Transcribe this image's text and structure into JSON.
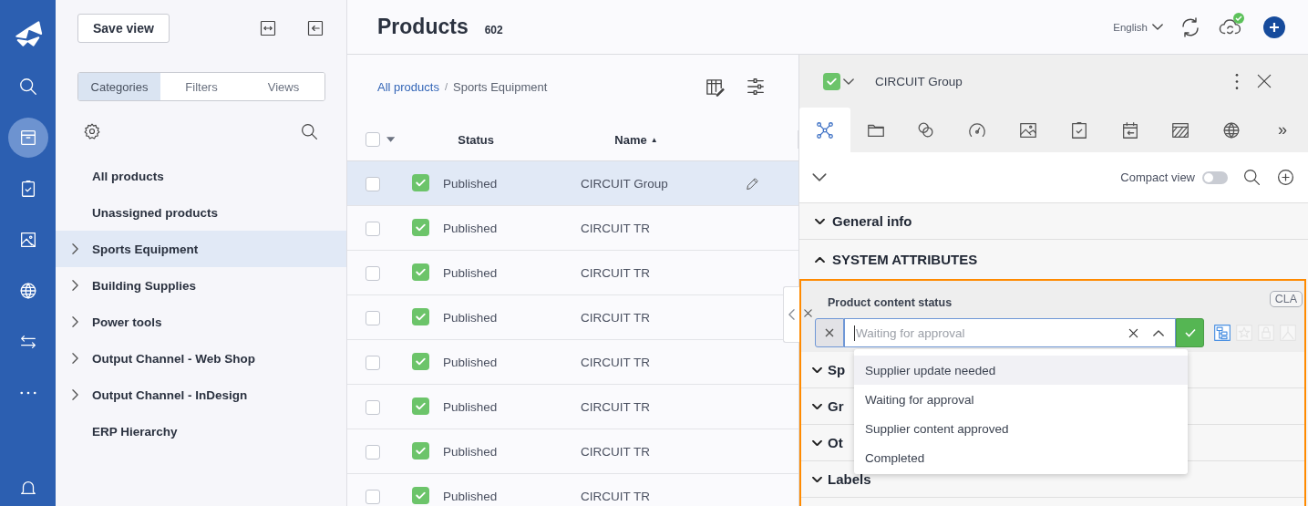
{
  "nav_rail": [
    {
      "kind": "logo",
      "selected": false
    },
    {
      "kind": "search",
      "selected": false
    },
    {
      "kind": "box",
      "selected": true
    },
    {
      "kind": "clipboard",
      "selected": false
    },
    {
      "kind": "image",
      "selected": false
    },
    {
      "kind": "globe",
      "selected": false
    },
    {
      "kind": "arrows",
      "selected": false
    },
    {
      "kind": "more",
      "selected": false
    },
    {
      "kind": "bell",
      "selected": false
    }
  ],
  "sidebar": {
    "save_button": "Save view",
    "tabs": [
      {
        "label": "Categories",
        "selected": true
      },
      {
        "label": "Filters",
        "selected": false
      },
      {
        "label": "Views",
        "selected": false
      }
    ],
    "tree": [
      {
        "label": "All products",
        "expandable": false,
        "selected": false
      },
      {
        "label": "Unassigned products",
        "expandable": false,
        "selected": false
      },
      {
        "label": "Sports Equipment",
        "expandable": true,
        "selected": true
      },
      {
        "label": "Building Supplies",
        "expandable": true,
        "selected": false
      },
      {
        "label": "Power tools",
        "expandable": true,
        "selected": false
      },
      {
        "label": "Output Channel - Web Shop",
        "expandable": true,
        "selected": false
      },
      {
        "label": "Output Channel - InDesign",
        "expandable": true,
        "selected": false
      },
      {
        "label": "ERP Hierarchy",
        "expandable": false,
        "selected": false
      }
    ]
  },
  "header": {
    "title": "Products",
    "count": "602",
    "language": "English",
    "sync_ok": true
  },
  "list": {
    "breadcrumb": {
      "link": "All products",
      "separator": "/",
      "current": "Sports Equipment"
    },
    "select_all": {
      "checked": false
    },
    "columns": [
      {
        "label": "Status"
      },
      {
        "label": "Name",
        "sort_indicator": "▲"
      }
    ],
    "rows": [
      {
        "checked": false,
        "selected": true,
        "status": "Published",
        "published": true,
        "name": "CIRCUIT Group"
      },
      {
        "checked": false,
        "selected": false,
        "status": "Published",
        "published": true,
        "name": "CIRCUIT TR"
      },
      {
        "checked": false,
        "selected": false,
        "status": "Published",
        "published": true,
        "name": "CIRCUIT TR"
      },
      {
        "checked": false,
        "selected": false,
        "status": "Published",
        "published": true,
        "name": "CIRCUIT TR"
      },
      {
        "checked": false,
        "selected": false,
        "status": "Published",
        "published": true,
        "name": "CIRCUIT TR"
      },
      {
        "checked": false,
        "selected": false,
        "status": "Published",
        "published": true,
        "name": "CIRCUIT TR"
      },
      {
        "checked": false,
        "selected": false,
        "status": "Published",
        "published": true,
        "name": "CIRCUIT TR"
      },
      {
        "checked": false,
        "selected": false,
        "status": "Published",
        "published": true,
        "name": "CIRCUIT TR"
      }
    ]
  },
  "detail": {
    "title": "CIRCUIT Group",
    "published": true,
    "tabs": [
      {
        "kind": "hierarchy",
        "selected": true
      },
      {
        "kind": "folder",
        "selected": false
      },
      {
        "kind": "links",
        "selected": false
      },
      {
        "kind": "gauge",
        "selected": false
      },
      {
        "kind": "image",
        "selected": false
      },
      {
        "kind": "clipboard",
        "selected": false
      },
      {
        "kind": "calendar",
        "selected": false
      },
      {
        "kind": "hatched",
        "selected": false
      },
      {
        "kind": "globe",
        "selected": false
      },
      {
        "kind": "more",
        "label": "»",
        "selected": false
      }
    ],
    "compact_view": {
      "label": "Compact view",
      "on": false
    },
    "sections": [
      {
        "label": "General info",
        "expanded": false
      },
      {
        "label": "SYSTEM ATTRIBUTES",
        "expanded": true
      }
    ],
    "attribute": {
      "label": "Product content status",
      "badge": "CLA",
      "placeholder": "Waiting for approval",
      "tools": [
        {
          "kind": "tree",
          "active": true
        },
        {
          "kind": "star",
          "active": false
        },
        {
          "kind": "lock",
          "active": false
        },
        {
          "kind": "split",
          "active": false
        }
      ],
      "options": [
        {
          "label": "Supplier update needed",
          "highlighted": true
        },
        {
          "label": "Waiting for approval",
          "highlighted": false
        },
        {
          "label": "Supplier content approved",
          "highlighted": false
        },
        {
          "label": "Completed",
          "highlighted": false
        }
      ]
    },
    "more_sections": [
      {
        "label": "Sp",
        "expanded": false
      },
      {
        "label": "Gr",
        "expanded": false
      },
      {
        "label": "Ot",
        "expanded": false
      },
      {
        "label": "Labels",
        "expanded": false
      }
    ]
  }
}
